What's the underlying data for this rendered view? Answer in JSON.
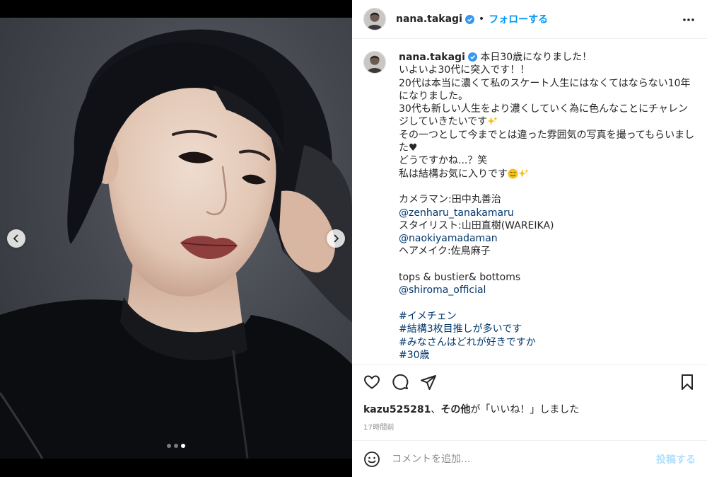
{
  "post": {
    "username": "nana.takagi",
    "follow_label": "フォローする",
    "separator": "•",
    "carousel": {
      "total": 3,
      "current": 3
    }
  },
  "caption": {
    "username": "nana.takagi",
    "lines": [
      "本日30歳になりました！",
      "いよいよ30代に突入です！！",
      "20代は本当に濃くて私のスケート人生にはなくてはならない10年になりました。",
      "30代も新しい人生をより濃くしていく為に色んなことにチャレンジしていきたいです",
      "その一つとして今までとは違った雰囲気の写真を撮ってもらいました",
      "どうですかね...？笑",
      "私は結構お気に入りです",
      "",
      "カメラマン:田中丸善治",
      "@zenharu_tanakamaru",
      "スタイリスト:山田直樹(WAREIKA)",
      "@naokiyamadaman",
      "ヘアメイク:佐鳥麻子",
      "",
      "tops & bustier& bottoms",
      "@shiroma_official",
      "",
      "#イメチェン",
      "#結構3枚目推しが多いです",
      "#みなさんはどれが好きですか",
      "#30歳"
    ],
    "heart_symbol": "♥"
  },
  "likes": {
    "user": "kazu525281",
    "mid": "、",
    "others": "その他",
    "suffix": "が「いいね！」しました"
  },
  "timestamp": "17時間前",
  "comment": {
    "placeholder": "コメントを追加...",
    "post_label": "投稿する"
  },
  "colors": {
    "link": "#00376b",
    "accent": "#0095f6",
    "post_disabled": "#b2dffc",
    "verified": "#3897f0"
  },
  "icons": {
    "verified": "verified-badge-icon",
    "more": "more-options-icon",
    "like": "heart-icon",
    "comment": "comment-icon",
    "share": "paper-plane-icon",
    "save": "bookmark-icon",
    "emoji": "smiley-icon",
    "prev": "chevron-left-icon",
    "next": "chevron-right-icon"
  }
}
